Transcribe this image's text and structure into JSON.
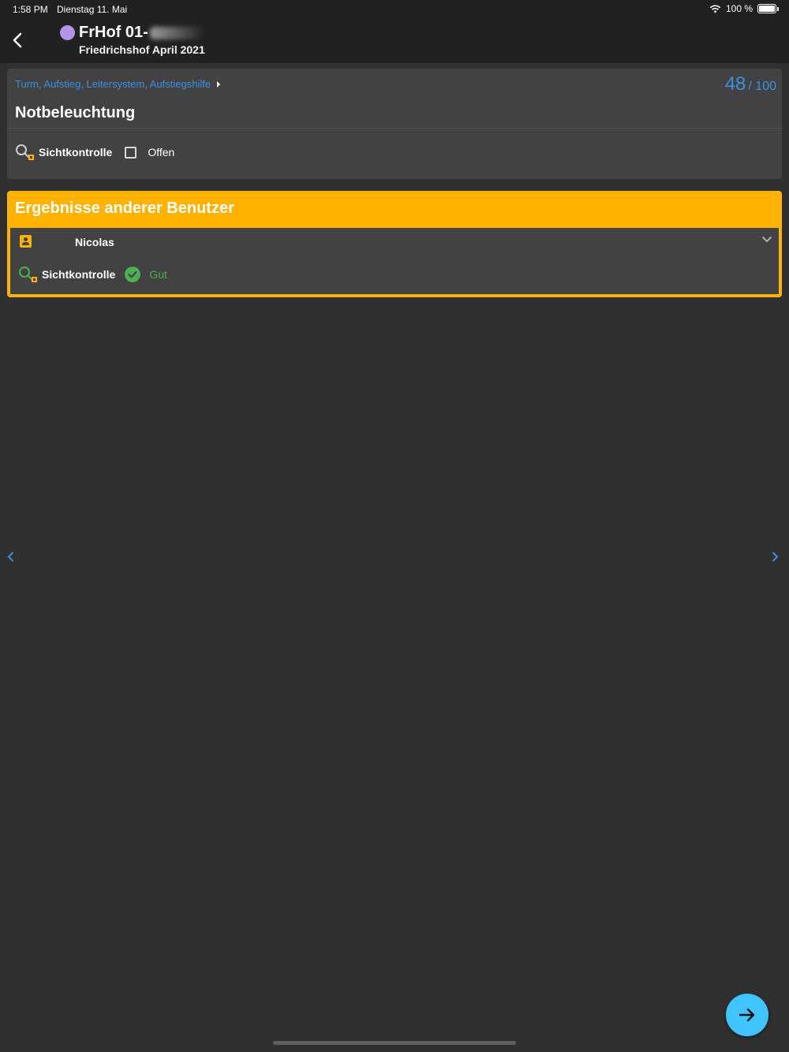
{
  "status_bar": {
    "time": "1:58 PM",
    "date": "Dienstag 11. Mai",
    "battery": "100 %",
    "battery_level": 1.0
  },
  "header": {
    "title": "FrHof 01-",
    "subtitle": "Friedrichshof April 2021",
    "dot_color": "#b394e6"
  },
  "card": {
    "breadcrumb": "Turm, Aufstieg, Leitersystem, Aufstiegshilfe",
    "progress_current": "48",
    "progress_separator": "/",
    "progress_total": "100",
    "title": "Notbeleuchtung",
    "check_label": "Sichtkontrolle",
    "check_status": "Offen"
  },
  "others": {
    "heading": "Ergebnisse anderer Benutzer",
    "accent_color": "#ffb300",
    "user_name": "Nicolas",
    "result_label": "Sichtkontrolle",
    "result_value": "Gut",
    "result_color": "#4caf50"
  },
  "colors": {
    "background": "#303030",
    "link": "#3d8fe0",
    "fab": "#40c4ff"
  },
  "icons": {
    "back": "back-arrow-icon",
    "visual_check": "magnifier-lock-icon",
    "user": "account-box-icon",
    "expand": "chevron-down-icon",
    "ok": "check-circle-icon",
    "prev": "chevron-left-icon",
    "next": "chevron-right-icon",
    "fab": "arrow-right-icon"
  }
}
